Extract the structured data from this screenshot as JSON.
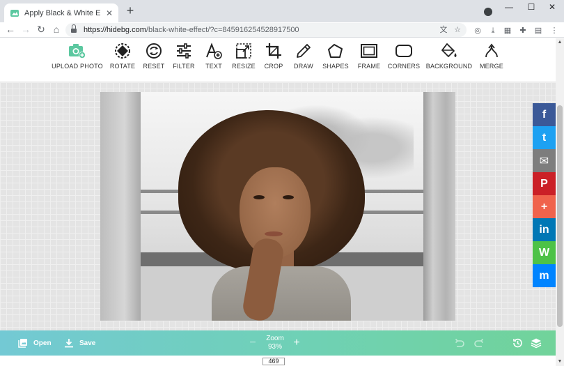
{
  "browser": {
    "tab_title": "Apply Black & White Effect Onl",
    "url_host": "https://hidebg.com",
    "url_path": "/black-white-effect/?c=845916254528917500"
  },
  "tools": [
    {
      "label": "UPLOAD PHOTO",
      "icon": "camera-plus-icon"
    },
    {
      "label": "ROTATE",
      "icon": "rotate-icon"
    },
    {
      "label": "RESET",
      "icon": "reset-icon"
    },
    {
      "label": "FILTER",
      "icon": "sliders-icon"
    },
    {
      "label": "TEXT",
      "icon": "text-add-icon"
    },
    {
      "label": "RESIZE",
      "icon": "resize-icon"
    },
    {
      "label": "CROP",
      "icon": "crop-icon"
    },
    {
      "label": "DRAW",
      "icon": "pencil-icon"
    },
    {
      "label": "SHAPES",
      "icon": "pentagon-icon"
    },
    {
      "label": "FRAME",
      "icon": "frame-icon"
    },
    {
      "label": "CORNERS",
      "icon": "rounded-rect-icon"
    },
    {
      "label": "BACKGROUND",
      "icon": "paint-bucket-icon"
    },
    {
      "label": "MERGE",
      "icon": "merge-icon"
    }
  ],
  "share": [
    {
      "name": "facebook",
      "glyph": "f",
      "color": "#3b5998"
    },
    {
      "name": "twitter",
      "glyph": "t",
      "color": "#1da1f2"
    },
    {
      "name": "email",
      "glyph": "✉",
      "color": "#7d7d7d"
    },
    {
      "name": "pinterest",
      "glyph": "P",
      "color": "#cb2027"
    },
    {
      "name": "more",
      "glyph": "+",
      "color": "#f0634c"
    },
    {
      "name": "linkedin",
      "glyph": "in",
      "color": "#0077b5"
    },
    {
      "name": "whatsapp",
      "glyph": "W",
      "color": "#4dc247"
    },
    {
      "name": "messenger",
      "glyph": "m",
      "color": "#0084ff"
    }
  ],
  "bottom": {
    "open_label": "Open",
    "save_label": "Save",
    "zoom_label": "Zoom",
    "zoom_value": "93%"
  },
  "page_indicator": "469",
  "accent": "#5cc8a0"
}
